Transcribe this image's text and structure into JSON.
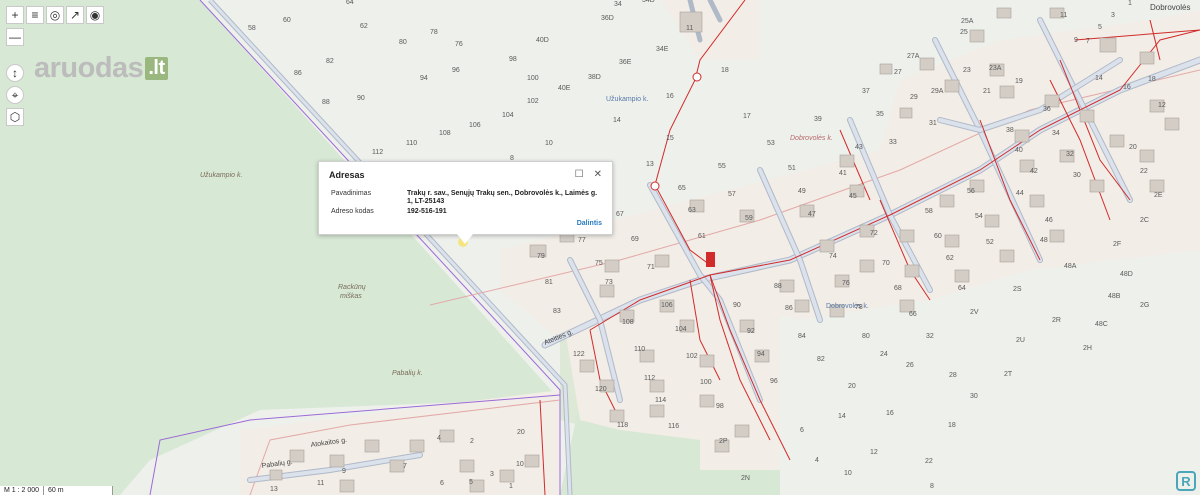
{
  "toolbar": {
    "zoom_in": "+",
    "zoom_out": "—"
  },
  "logo": {
    "text": "aruodas",
    "suffix": ".lt"
  },
  "popup": {
    "title": "Adresas",
    "name_label": "Pavadinimas",
    "name_value": "Trakų r. sav., Senųjų Trakų sen., Dobrovolės k., Laimės g. 1, LT-25143",
    "code_label": "Adreso kodas",
    "code_value": "192-516-191",
    "share": "Dalintis"
  },
  "places": {
    "uzukampio_k_blue": "Užukampio k.",
    "uzukampio_k": "Užukampio k.",
    "rackunu": "Rackūnų",
    "miskas": "miškas",
    "pabaliu": "Pabalių k.",
    "dobrovoles_top": "Dobrovolės",
    "dobrovoles_mid": "Dobrovolės k.",
    "dobrovoles_blue": "Dobrovolės k.",
    "pabaliu_street": "Pabalių g.",
    "ateities": "Ateities g.",
    "atokaitos": "Atokaitos g.",
    "dob_partial": "Dob...",
    "dobrovoles_g": "D..."
  },
  "scale": {
    "ratio": "M 1 : 2 000",
    "distance": "60 m"
  },
  "parcel_numbers": [
    "58",
    "60",
    "64",
    "34",
    "36D",
    "34D",
    "62",
    "78",
    "76",
    "40D",
    "80",
    "98",
    "82",
    "96",
    "34E",
    "86",
    "94",
    "100",
    "36E",
    "38D",
    "90",
    "102",
    "40E",
    "88",
    "104",
    "106",
    "108",
    "110",
    "112",
    "8",
    "10",
    "14",
    "15",
    "16",
    "17",
    "18",
    "11",
    "13",
    "65",
    "53",
    "51",
    "57",
    "67",
    "55",
    "39",
    "61",
    "63",
    "37",
    "35",
    "33",
    "31",
    "27A",
    "27",
    "25",
    "25A",
    "23",
    "23A",
    "29",
    "29A",
    "21",
    "19",
    "11",
    "9",
    "7",
    "5",
    "3",
    "1",
    "14",
    "16",
    "18",
    "12",
    "36",
    "38",
    "34",
    "40",
    "32",
    "30",
    "44",
    "42",
    "20",
    "22",
    "24",
    "26",
    "28",
    "46",
    "48",
    "50",
    "52",
    "54",
    "56",
    "58",
    "60",
    "62",
    "64",
    "66",
    "68",
    "70",
    "72",
    "74",
    "76",
    "78",
    "80",
    "82",
    "84",
    "86",
    "88",
    "90",
    "92",
    "94",
    "96",
    "98",
    "100",
    "102",
    "104",
    "106",
    "108",
    "110",
    "112",
    "114",
    "116",
    "118",
    "120",
    "122",
    "2C",
    "2E",
    "2F",
    "2G",
    "2H",
    "2N",
    "2P",
    "2R",
    "2S",
    "2T",
    "2U",
    "2V",
    "48A",
    "48B",
    "48C",
    "48D",
    "20",
    "6",
    "4",
    "9",
    "11",
    "13",
    "2",
    "24",
    "47",
    "45",
    "41",
    "43",
    "49",
    "59",
    "69",
    "71",
    "73",
    "75",
    "77",
    "79",
    "81",
    "83"
  ],
  "colors": {
    "forest": "#d7e8d4",
    "settlement": "#f2ede6",
    "road_outline": "#b0b9c8",
    "road": "#c9d3e2",
    "utility": "#d22b2b",
    "purple": "#9c6ad8",
    "pink": "#e3a9a9",
    "building": "#d3cdc6",
    "bldg_stroke": "#a8a29b"
  }
}
